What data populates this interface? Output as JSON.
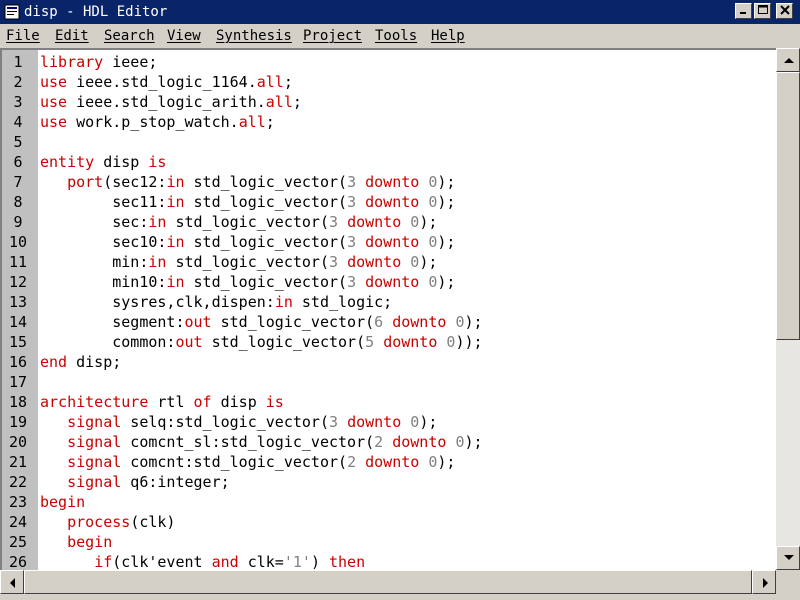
{
  "window": {
    "title": "disp - HDL Editor",
    "minimize_label": "_",
    "maximize_label": "□",
    "close_label": "X"
  },
  "menu": [
    {
      "label": "File"
    },
    {
      "label": "Edit"
    },
    {
      "label": "Search"
    },
    {
      "label": "View"
    },
    {
      "label": "Synthesis"
    },
    {
      "label": "Project"
    },
    {
      "label": "Tools"
    },
    {
      "label": "Help"
    }
  ],
  "colors": {
    "keyword": "#cc0000",
    "number": "#808080",
    "title_bar": "#0a246a",
    "gutter": "#c0c0c0"
  },
  "editor": {
    "lines": [
      {
        "n": "1",
        "tokens": [
          [
            "k",
            "library"
          ],
          [
            "t",
            " ieee;"
          ]
        ]
      },
      {
        "n": "2",
        "tokens": [
          [
            "k",
            "use"
          ],
          [
            "t",
            " ieee.std_logic_1164."
          ],
          [
            "k",
            "all"
          ],
          [
            "t",
            ";"
          ]
        ]
      },
      {
        "n": "3",
        "tokens": [
          [
            "k",
            "use"
          ],
          [
            "t",
            " ieee.std_logic_arith."
          ],
          [
            "k",
            "all"
          ],
          [
            "t",
            ";"
          ]
        ]
      },
      {
        "n": "4",
        "tokens": [
          [
            "k",
            "use"
          ],
          [
            "t",
            " work.p_stop_watch."
          ],
          [
            "k",
            "all"
          ],
          [
            "t",
            ";"
          ]
        ]
      },
      {
        "n": "5",
        "tokens": []
      },
      {
        "n": "6",
        "tokens": [
          [
            "k",
            "entity"
          ],
          [
            "t",
            " disp "
          ],
          [
            "k",
            "is"
          ]
        ]
      },
      {
        "n": "7",
        "tokens": [
          [
            "t",
            "   "
          ],
          [
            "k",
            "port"
          ],
          [
            "t",
            "(sec12:"
          ],
          [
            "k",
            "in"
          ],
          [
            "t",
            " std_logic_vector("
          ],
          [
            "d",
            "3"
          ],
          [
            "t",
            " "
          ],
          [
            "k",
            "downto"
          ],
          [
            "t",
            " "
          ],
          [
            "d",
            "0"
          ],
          [
            "t",
            ");"
          ]
        ]
      },
      {
        "n": "8",
        "tokens": [
          [
            "t",
            "        sec11:"
          ],
          [
            "k",
            "in"
          ],
          [
            "t",
            " std_logic_vector("
          ],
          [
            "d",
            "3"
          ],
          [
            "t",
            " "
          ],
          [
            "k",
            "downto"
          ],
          [
            "t",
            " "
          ],
          [
            "d",
            "0"
          ],
          [
            "t",
            ");"
          ]
        ]
      },
      {
        "n": "9",
        "tokens": [
          [
            "t",
            "        sec:"
          ],
          [
            "k",
            "in"
          ],
          [
            "t",
            " std_logic_vector("
          ],
          [
            "d",
            "3"
          ],
          [
            "t",
            " "
          ],
          [
            "k",
            "downto"
          ],
          [
            "t",
            " "
          ],
          [
            "d",
            "0"
          ],
          [
            "t",
            ");"
          ]
        ]
      },
      {
        "n": "10",
        "tokens": [
          [
            "t",
            "        sec10:"
          ],
          [
            "k",
            "in"
          ],
          [
            "t",
            " std_logic_vector("
          ],
          [
            "d",
            "3"
          ],
          [
            "t",
            " "
          ],
          [
            "k",
            "downto"
          ],
          [
            "t",
            " "
          ],
          [
            "d",
            "0"
          ],
          [
            "t",
            ");"
          ]
        ]
      },
      {
        "n": "11",
        "tokens": [
          [
            "t",
            "        min:"
          ],
          [
            "k",
            "in"
          ],
          [
            "t",
            " std_logic_vector("
          ],
          [
            "d",
            "3"
          ],
          [
            "t",
            " "
          ],
          [
            "k",
            "downto"
          ],
          [
            "t",
            " "
          ],
          [
            "d",
            "0"
          ],
          [
            "t",
            ");"
          ]
        ]
      },
      {
        "n": "12",
        "tokens": [
          [
            "t",
            "        min10:"
          ],
          [
            "k",
            "in"
          ],
          [
            "t",
            " std_logic_vector("
          ],
          [
            "d",
            "3"
          ],
          [
            "t",
            " "
          ],
          [
            "k",
            "downto"
          ],
          [
            "t",
            " "
          ],
          [
            "d",
            "0"
          ],
          [
            "t",
            ");"
          ]
        ]
      },
      {
        "n": "13",
        "tokens": [
          [
            "t",
            "        sysres,clk,dispen:"
          ],
          [
            "k",
            "in"
          ],
          [
            "t",
            " std_logic;"
          ]
        ]
      },
      {
        "n": "14",
        "tokens": [
          [
            "t",
            "        segment:"
          ],
          [
            "k",
            "out"
          ],
          [
            "t",
            " std_logic_vector("
          ],
          [
            "d",
            "6"
          ],
          [
            "t",
            " "
          ],
          [
            "k",
            "downto"
          ],
          [
            "t",
            " "
          ],
          [
            "d",
            "0"
          ],
          [
            "t",
            ");"
          ]
        ]
      },
      {
        "n": "15",
        "tokens": [
          [
            "t",
            "        common:"
          ],
          [
            "k",
            "out"
          ],
          [
            "t",
            " std_logic_vector("
          ],
          [
            "d",
            "5"
          ],
          [
            "t",
            " "
          ],
          [
            "k",
            "downto"
          ],
          [
            "t",
            " "
          ],
          [
            "d",
            "0"
          ],
          [
            "t",
            "));"
          ]
        ]
      },
      {
        "n": "16",
        "tokens": [
          [
            "k",
            "end"
          ],
          [
            "t",
            " disp;"
          ]
        ]
      },
      {
        "n": "17",
        "tokens": []
      },
      {
        "n": "18",
        "tokens": [
          [
            "k",
            "architecture"
          ],
          [
            "t",
            " rtl "
          ],
          [
            "k",
            "of"
          ],
          [
            "t",
            " disp "
          ],
          [
            "k",
            "is"
          ]
        ]
      },
      {
        "n": "19",
        "tokens": [
          [
            "t",
            "   "
          ],
          [
            "k",
            "signal"
          ],
          [
            "t",
            " selq:std_logic_vector("
          ],
          [
            "d",
            "3"
          ],
          [
            "t",
            " "
          ],
          [
            "k",
            "downto"
          ],
          [
            "t",
            " "
          ],
          [
            "d",
            "0"
          ],
          [
            "t",
            ");"
          ]
        ]
      },
      {
        "n": "20",
        "tokens": [
          [
            "t",
            "   "
          ],
          [
            "k",
            "signal"
          ],
          [
            "t",
            " comcnt_sl:std_logic_vector("
          ],
          [
            "d",
            "2"
          ],
          [
            "t",
            " "
          ],
          [
            "k",
            "downto"
          ],
          [
            "t",
            " "
          ],
          [
            "d",
            "0"
          ],
          [
            "t",
            ");"
          ]
        ]
      },
      {
        "n": "21",
        "tokens": [
          [
            "t",
            "   "
          ],
          [
            "k",
            "signal"
          ],
          [
            "t",
            " comcnt:std_logic_vector("
          ],
          [
            "d",
            "2"
          ],
          [
            "t",
            " "
          ],
          [
            "k",
            "downto"
          ],
          [
            "t",
            " "
          ],
          [
            "d",
            "0"
          ],
          [
            "t",
            ");"
          ]
        ]
      },
      {
        "n": "22",
        "tokens": [
          [
            "t",
            "   "
          ],
          [
            "k",
            "signal"
          ],
          [
            "t",
            " q6:integer;"
          ]
        ]
      },
      {
        "n": "23",
        "tokens": [
          [
            "k",
            "begin"
          ]
        ]
      },
      {
        "n": "24",
        "tokens": [
          [
            "t",
            "   "
          ],
          [
            "k",
            "process"
          ],
          [
            "t",
            "(clk)"
          ]
        ]
      },
      {
        "n": "25",
        "tokens": [
          [
            "t",
            "   "
          ],
          [
            "k",
            "begin"
          ]
        ]
      },
      {
        "n": "26",
        "tokens": [
          [
            "t",
            "      "
          ],
          [
            "k",
            "if"
          ],
          [
            "t",
            "(clk'event "
          ],
          [
            "k",
            "and"
          ],
          [
            "t",
            " clk="
          ],
          [
            "d",
            "'1'"
          ],
          [
            "t",
            ") "
          ],
          [
            "k",
            "then"
          ]
        ]
      }
    ]
  },
  "vertical_scroll_fraction": 0.0,
  "horizontal_scroll_fraction": 0.0
}
